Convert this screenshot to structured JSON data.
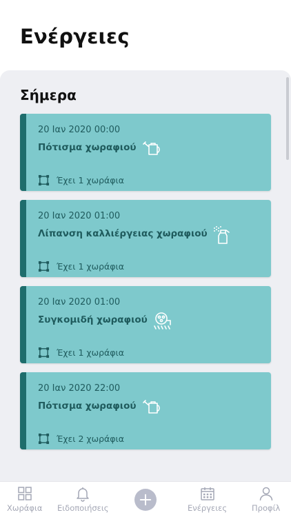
{
  "page": {
    "title": "Ενέργειες"
  },
  "section": {
    "title": "Σήμερα"
  },
  "cards": [
    {
      "date": "20 Ιαν 2020 00:00",
      "title": "Πότισμα χωραφιού",
      "icon": "watering-can-icon",
      "fields_text": "Έχει 1 χωράφια"
    },
    {
      "date": "20 Ιαν 2020 01:00",
      "title": "Λίπανση καλλιέργειας χωραφιού",
      "icon": "spray-bottle-icon",
      "fields_text": "Έχει 1 χωράφια"
    },
    {
      "date": "20 Ιαν 2020 01:00",
      "title": "Συγκομιδή χωραφιού",
      "icon": "harvester-icon",
      "fields_text": "Έχει 1 χωράφια"
    },
    {
      "date": "20 Ιαν 2020 22:00",
      "title": "Πότισμα χωραφιού",
      "icon": "watering-can-icon",
      "fields_text": "Έχει 2 χωράφια"
    }
  ],
  "tabbar": {
    "fields": "Χωράφια",
    "notifications": "Ειδοποιήσεις",
    "actions": "Ενέργειες",
    "profile": "Προφίλ"
  },
  "colors": {
    "card_background": "#7ec9cc",
    "card_accent": "#1e6d6c",
    "card_text": "#1f5b5d",
    "panel_background": "#eeeff3",
    "tab_inactive": "#a4a7b5"
  }
}
